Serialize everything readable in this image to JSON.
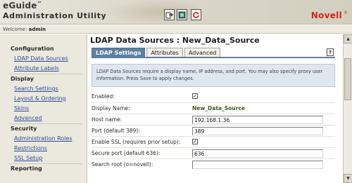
{
  "header": {
    "brand": "eGuide",
    "brand_tm": "™",
    "subtitle": "Administration Utility",
    "logo": "Novell",
    "logo_mark": "®",
    "buttons": [
      {
        "icon": "export-icon"
      },
      {
        "icon": "document-icon"
      },
      {
        "icon": "refresh-icon"
      }
    ]
  },
  "welcome": {
    "label": "Welcome:",
    "user": "admin"
  },
  "sidebar": {
    "sections": [
      {
        "title": "Configuration",
        "items": [
          "LDAP Data Sources",
          "Attribute Labels"
        ]
      },
      {
        "title": "Display",
        "items": [
          "Search Settings",
          "Layout & Ordering",
          "Skins",
          "Advanced"
        ]
      },
      {
        "title": "Security",
        "items": [
          "Administration Roles",
          "Restrictions",
          "SSL Setup"
        ]
      },
      {
        "title": "Reporting",
        "items": []
      }
    ]
  },
  "main": {
    "title": "LDAP Data Sources : New_Data_Source",
    "tabs": [
      "LDAP Settings",
      "Attributes",
      "Advanced"
    ],
    "active_tab": "LDAP Settings",
    "help_label": "?",
    "info": "LDAP Data Sources require a display name, IP address, and port. You may also specify proxy user information. Press Save to apply changes.",
    "form": {
      "enabled_label": "Enabled:",
      "enabled_checked": true,
      "display_name_label": "Display Name:",
      "display_name_value": "New_Data_Source",
      "host_label": "Host name:",
      "host_value": "192.168.1.36",
      "port_label": "Port (default 389):",
      "port_value": "389",
      "ssl_label": "Enable SSL (requires prior setup):",
      "ssl_checked": true,
      "secure_port_label": "Secure port (default 636):",
      "secure_port_value": "636",
      "search_root_label": "Search root (o=novell):",
      "search_root_value": ""
    }
  },
  "colors": {
    "accent_tab": "#5e7fa0",
    "link": "#2b4f9a",
    "novell_red": "#d0261b",
    "display_name": "#3d5a14"
  }
}
